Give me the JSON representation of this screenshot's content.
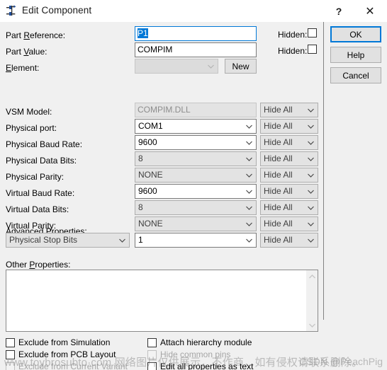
{
  "window": {
    "title": "Edit Component",
    "icon": "component-icon",
    "help_button": "?",
    "close_button": "✕"
  },
  "form": {
    "part_reference": {
      "label_pre": "Part ",
      "label_mn": "R",
      "label_post": "eference:",
      "value": "P1",
      "hidden_label": "Hidden:",
      "hidden_checked": false
    },
    "part_value": {
      "label_pre": "Part ",
      "label_mn": "V",
      "label_post": "alue:",
      "value": "COMPIM",
      "hidden_label": "Hidden:",
      "hidden_checked": false
    },
    "element": {
      "label_pre": "",
      "label_mn": "E",
      "label_post": "lement:",
      "value": "",
      "new_button": "New"
    },
    "vsm_model": {
      "label": "VSM Model:",
      "value": "COMPIM.DLL",
      "hide": "Hide All"
    },
    "rows": [
      {
        "label": "Physical port:",
        "value": "COM1",
        "state": "editable",
        "hide": "Hide All"
      },
      {
        "label": "Physical Baud Rate:",
        "value": "9600",
        "state": "editable",
        "hide": "Hide All"
      },
      {
        "label": "Physical Data Bits:",
        "value": "8",
        "state": "grey",
        "hide": "Hide All"
      },
      {
        "label": "Physical Parity:",
        "value": "NONE",
        "state": "grey",
        "hide": "Hide All"
      },
      {
        "label": "Virtual Baud Rate:",
        "value": "9600",
        "state": "editable",
        "hide": "Hide All"
      },
      {
        "label": "Virtual Data Bits:",
        "value": "8",
        "state": "grey",
        "hide": "Hide All"
      },
      {
        "label": "Virtual Parity:",
        "value": "NONE",
        "state": "grey",
        "hide": "Hide All"
      }
    ],
    "advanced": {
      "label": "Advanced Properties:",
      "property": "Physical Stop Bits",
      "value": "1",
      "hide": "Hide All"
    },
    "other": {
      "label_pre": "Other ",
      "label_mn": "P",
      "label_post": "roperties:",
      "value": ""
    }
  },
  "options": {
    "exclude_simulation": {
      "label": "Exclude from Simulation",
      "checked": false,
      "enabled": true
    },
    "exclude_pcb": {
      "label": "Exclude from PCB Layout",
      "checked": false,
      "enabled": true
    },
    "exclude_variant": {
      "label": "Exclude from Current Variant",
      "checked": false,
      "enabled": false
    },
    "attach_hierarchy": {
      "label": "Attach hierarchy module",
      "checked": false,
      "enabled": true
    },
    "hide_common_pins": {
      "label": "Hide common pins",
      "checked": false,
      "enabled": false
    },
    "edit_all_as_text": {
      "label": "Edit all properties as text",
      "checked": false,
      "enabled": true
    }
  },
  "buttons": {
    "ok": "OK",
    "help": "Help",
    "cancel": "Cancel"
  },
  "watermark": {
    "main": "www.toybrosubto·com 网络图片仅供展示，不作商，如有侵权请联系删除。",
    "csdn": "CSDN @PeachPig"
  },
  "colors": {
    "accent": "#0078d7",
    "dialog_bg": "#f0f0f0",
    "field_bg": "#ffffff",
    "disabled_bg": "#e3e3e3",
    "text": "#000000"
  }
}
